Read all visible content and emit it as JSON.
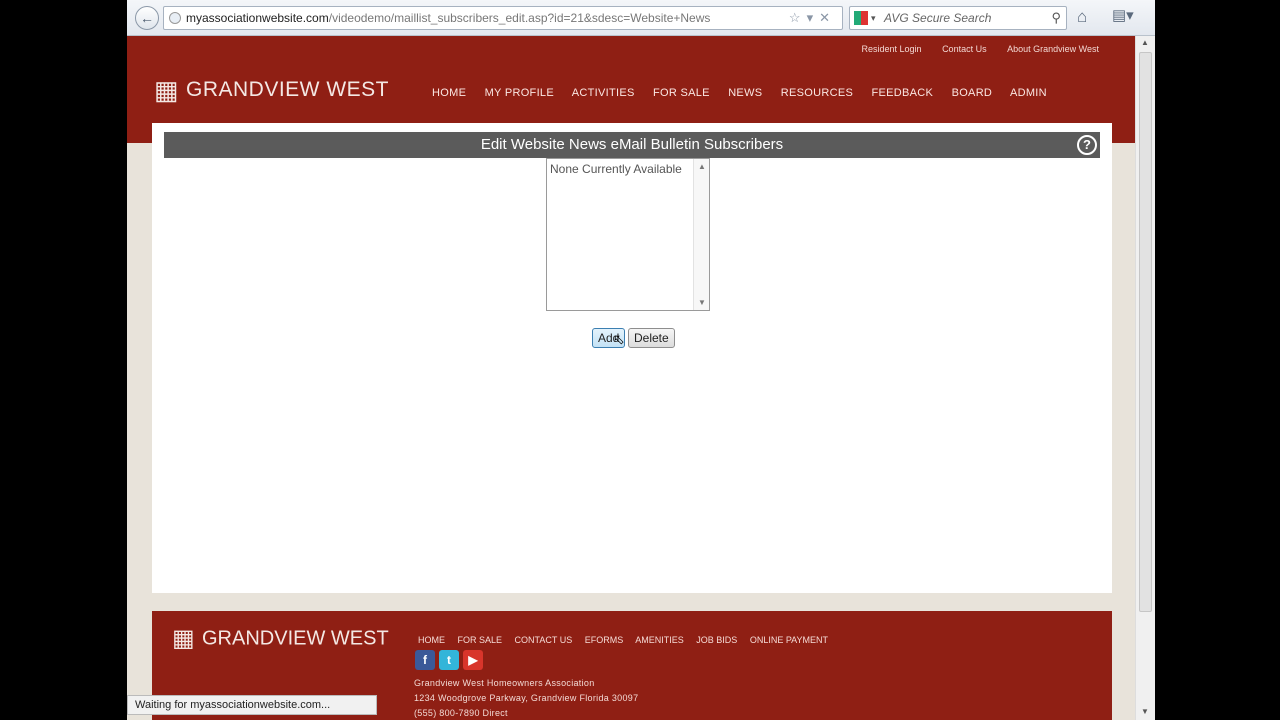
{
  "browser": {
    "url_host": "myassociationwebsite.com",
    "url_path": "/videodemo/maillist_subscribers_edit.asp?id=21&sdesc=Website+News",
    "search_placeholder": "AVG Secure Search",
    "status_text": "Waiting for myassociationwebsite.com..."
  },
  "header": {
    "utility_nav": [
      "Resident Login",
      "Contact Us",
      "About Grandview West"
    ],
    "logo_text": "GRANDVIEW WEST",
    "main_nav": [
      "HOME",
      "MY PROFILE",
      "ACTIVITIES",
      "FOR SALE",
      "NEWS",
      "RESOURCES",
      "FEEDBACK",
      "BOARD",
      "ADMIN"
    ]
  },
  "content": {
    "title": "Edit Website News eMail Bulletin Subscribers",
    "help_label": "?",
    "list_empty_text": "None Currently Available",
    "add_label": "Add",
    "delete_label": "Delete"
  },
  "footer": {
    "logo_text": "GRANDVIEW WEST",
    "nav": [
      "HOME",
      "FOR SALE",
      "CONTACT US",
      "EFORMS",
      "AMENITIES",
      "JOB BIDS",
      "ONLINE PAYMENT"
    ],
    "social": [
      "facebook",
      "twitter",
      "youtube"
    ],
    "address_lines": [
      "Grandview West Homeowners Association",
      "1234 Woodgrove Parkway, Grandview Florida 30097",
      "(555) 800-7890 Direct"
    ]
  },
  "colors": {
    "brand_red": "#8f1f14",
    "title_bar": "#5b5b5b",
    "page_bg": "#e8e3da"
  }
}
